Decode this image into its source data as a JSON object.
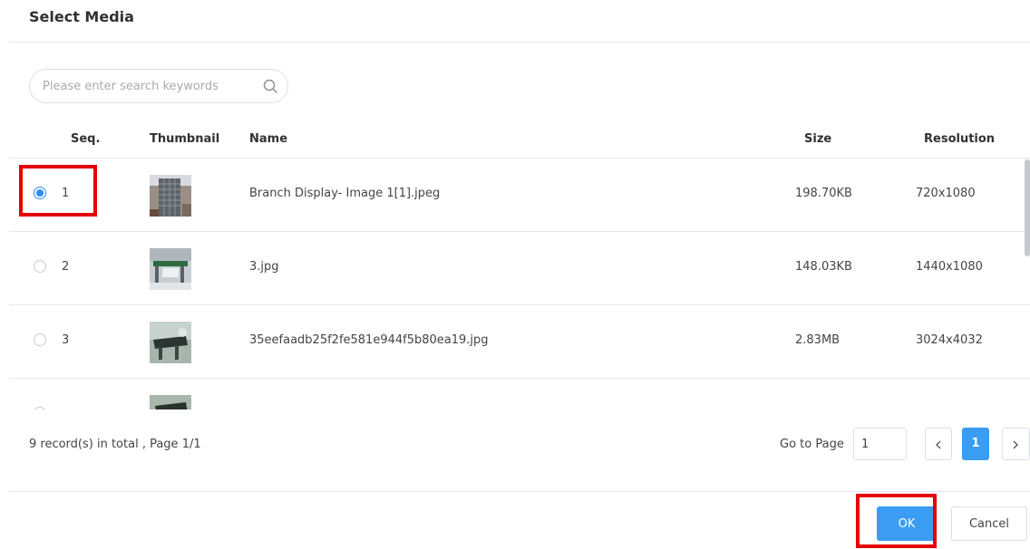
{
  "dialog": {
    "title": "Select Media"
  },
  "search": {
    "placeholder": "Please enter search keywords",
    "value": ""
  },
  "table": {
    "columns": [
      "Seq.",
      "Thumbnail",
      "Name",
      "Size",
      "Resolution"
    ],
    "rows": [
      {
        "seq": "1",
        "name": "Branch Display- Image 1[1].jpeg",
        "size": "198.70KB",
        "resolution": "720x1080",
        "selected": true
      },
      {
        "seq": "2",
        "name": "3.jpg",
        "size": "148.03KB",
        "resolution": "1440x1080",
        "selected": false
      },
      {
        "seq": "3",
        "name": "35eefaadb25f2fe581e944f5b80ea19.jpg",
        "size": "2.83MB",
        "resolution": "3024x4032",
        "selected": false
      }
    ]
  },
  "footer": {
    "summary": "9 record(s) in total , Page 1/1",
    "goto_label": "Go to Page",
    "goto_value": "1",
    "current_page": "1"
  },
  "actions": {
    "ok_label": "OK",
    "cancel_label": "Cancel"
  },
  "colors": {
    "accent": "#3a9cf2",
    "highlight": "#e60000"
  },
  "icons": {
    "search": "search-icon",
    "prev": "chevron-left-icon",
    "next": "chevron-right-icon"
  }
}
